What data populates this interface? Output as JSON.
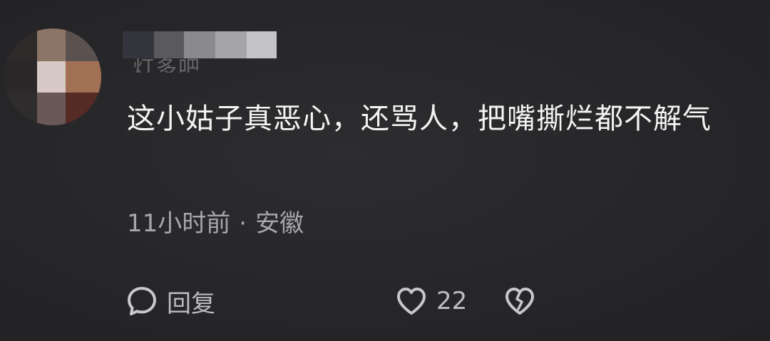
{
  "comment": {
    "username_obscured": "灯多吧",
    "text": "这小姑子真恶心，还骂人，把嘴撕烂都不解气",
    "time": "11小时前",
    "separator": "·",
    "location": "安徽"
  },
  "actions": {
    "reply_label": "回复",
    "like_count": "22"
  },
  "icons": {
    "reply": "speech-bubble-icon",
    "like": "heart-outline-icon",
    "dislike": "broken-heart-icon"
  },
  "colors": {
    "background": "#272729",
    "text_primary": "#f4f4f4",
    "text_secondary": "#a7a7aa",
    "icon": "#c8c8cb"
  }
}
